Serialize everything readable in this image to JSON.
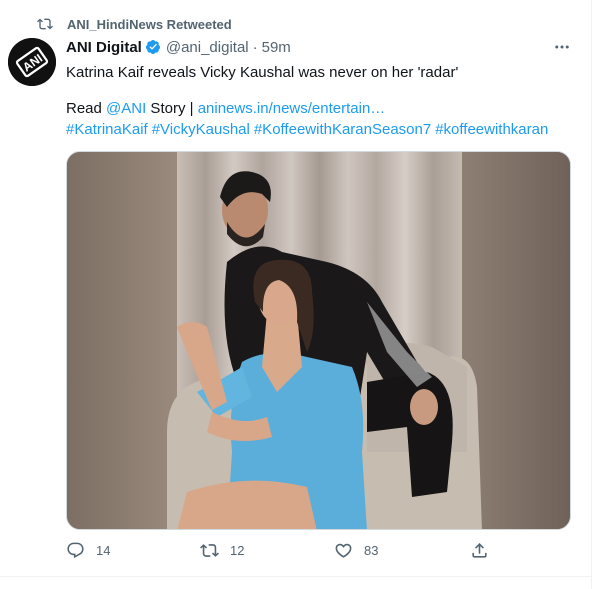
{
  "retweet_banner": {
    "label": "ANI_HindiNews Retweeted"
  },
  "author": {
    "name": "ANI Digital",
    "handle": "@ani_digital",
    "separator": "·",
    "time": "59m",
    "avatar_text": "ANI"
  },
  "tweet": {
    "line1": "Katrina Kaif reveals Vicky Kaushal was never on her 'radar'",
    "read_prefix": "Read ",
    "mention": "@ANI",
    "story_text": " Story | ",
    "link": "aninews.in/news/entertain…",
    "hashtags": [
      "#KatrinaKaif",
      "#VickyKaushal",
      "#KoffeewithKaranSeason7",
      "#koffeewithkaran"
    ]
  },
  "actions": {
    "reply_count": "14",
    "retweet_count": "12",
    "like_count": "83"
  },
  "colors": {
    "accent": "#1d9bf0",
    "secondary_text": "#536471",
    "primary_text": "#0f1419",
    "verified": "#1d9bf0"
  },
  "icons": {
    "retweet_banner": "retweet-icon",
    "verified": "verified-badge-icon",
    "more": "more-dots-icon",
    "reply": "reply-icon",
    "retweet": "retweet-icon",
    "like": "heart-icon",
    "share": "share-icon"
  }
}
